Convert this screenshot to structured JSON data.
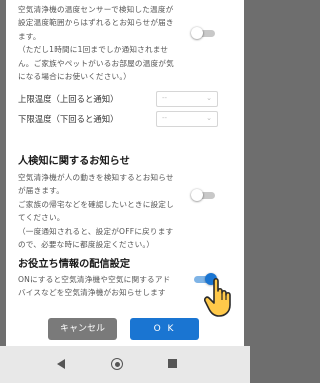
{
  "temp_section": {
    "description": "空気清浄機の温度センサーで検知した温度が\n設定温度範囲からはずれるとお知らせが届き\nます。\n（ただし1時間に1回までしか通知されませ\nん。ご家族やペットがいるお部屋の温度が気\nになる場合にお使いください。）",
    "toggle_state": "off",
    "upper_label": "上限温度（上回ると通知）",
    "upper_value": "--",
    "lower_label": "下限温度（下回ると通知）",
    "lower_value": "--"
  },
  "motion_section": {
    "heading": "人検知に関するお知らせ",
    "description": "空気清浄機が人の動きを検知するとお知らせ\nが届きます。\nご家族の帰宅などを確認したいときに設定し\nてください。\n（一度通知されると、設定がOFFに戻ります\nので、必要な時に都度設定ください。）",
    "toggle_state": "off"
  },
  "info_section": {
    "heading": "お役立ち情報の配信設定",
    "description": "ONにすると空気清浄機や空気に関するアド\nバイスなどを空気清浄機がお知らせします",
    "toggle_state": "on"
  },
  "buttons": {
    "cancel": "キャンセル",
    "ok": "O K"
  },
  "colors": {
    "accent": "#1a75d2",
    "cancel": "#7a7a7a"
  }
}
